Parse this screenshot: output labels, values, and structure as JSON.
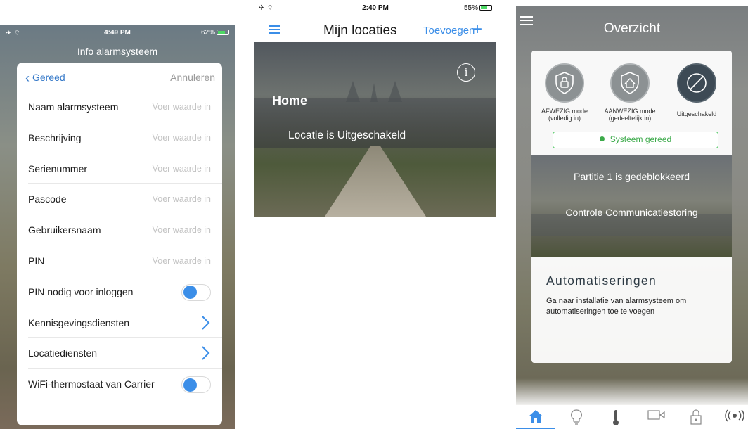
{
  "screen1": {
    "status": {
      "left": "✈ ⌔",
      "time": "4:49 PM",
      "battery": "62%"
    },
    "title": "Info alarmsysteem",
    "back_label": "Gereed",
    "cancel_label": "Annuleren",
    "rows": [
      {
        "label": "Naam alarmsysteem",
        "placeholder": "Voer waarde in"
      },
      {
        "label": "Beschrijving",
        "placeholder": "Voer waarde in"
      },
      {
        "label": "Serienummer",
        "placeholder": "Voer waarde in"
      },
      {
        "label": "Pascode",
        "placeholder": "Voer waarde in"
      },
      {
        "label": "Gebruikersnaam",
        "placeholder": "Voer waarde in"
      },
      {
        "label": "PIN",
        "placeholder": "Voer waarde in"
      }
    ],
    "pin_login_label": "PIN nodig voor inloggen",
    "notifications_label": "Kennisgevingsdiensten",
    "location_label": "Locatiediensten",
    "wifi_label": "WiFi-thermostaat van Carrier"
  },
  "screen2": {
    "status": {
      "left": "✈ ⌔",
      "time": "2:40 PM",
      "battery": "55%"
    },
    "title": "Mijn locaties",
    "add_label": "Toevoegen",
    "location_name": "Home",
    "location_state": "Locatie is Uitgeschakeld",
    "accent": "#3b8ee8"
  },
  "screen3": {
    "title": "Overzicht",
    "modes": [
      {
        "label1": "AFWEZIG mode",
        "label2": "(volledig in)",
        "icon": "shield-lock-icon"
      },
      {
        "label1": "AANWEZIG mode",
        "label2": "(gedeeltelijk in)",
        "icon": "shield-home-icon"
      },
      {
        "label1": "Uitgeschakeld",
        "label2": "",
        "icon": "disabled-icon"
      }
    ],
    "system_ready": "Systeem gereed",
    "partition_msg": "Partitie 1 is gedeblokkeerd",
    "comm_msg": "Controle Communicatiestoring",
    "automations_title": "Automatiseringen",
    "automations_desc": "Ga naar installatie van alarmsysteem om automatiseringen toe te voegen",
    "tabs": [
      "home-icon",
      "bulb-icon",
      "thermometer-icon",
      "camera-icon",
      "lock-icon",
      "signal-icon"
    ],
    "ready_color": "#3caa4a"
  }
}
